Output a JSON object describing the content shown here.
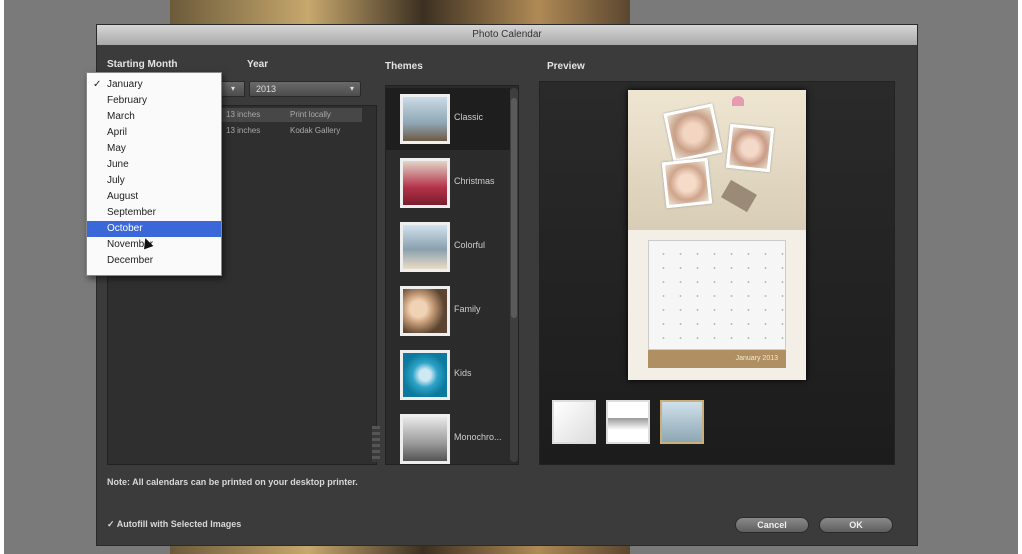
{
  "window": {
    "title": "Photo Calendar"
  },
  "labels": {
    "starting_month": "Starting Month",
    "year": "Year",
    "themes": "Themes",
    "preview": "Preview"
  },
  "year_select": {
    "value": "2013"
  },
  "sizes": [
    {
      "size": "13 inches",
      "printer": "Print locally"
    },
    {
      "size": "13 inches",
      "printer": "Kodak Gallery"
    }
  ],
  "months": [
    "January",
    "February",
    "March",
    "April",
    "May",
    "June",
    "July",
    "August",
    "September",
    "October",
    "November",
    "December"
  ],
  "month_menu": {
    "checked": "January",
    "highlighted": "October"
  },
  "themes": [
    "Classic",
    "Christmas",
    "Colorful",
    "Family",
    "Kids",
    "Monochro..."
  ],
  "preview": {
    "calendar_month_label": "January 2013"
  },
  "note": "Note: All calendars can be printed on your desktop printer.",
  "autofill": "Autofill with Selected Images",
  "buttons": {
    "cancel": "Cancel",
    "ok": "OK"
  },
  "colors": {
    "accent": "#3a68d8",
    "dialog": "#3b3b3b",
    "calendar_bar": "#b08f62"
  }
}
